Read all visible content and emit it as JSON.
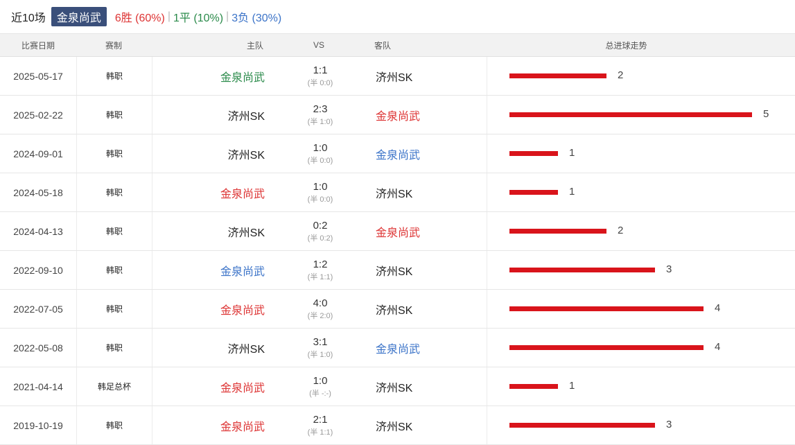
{
  "header": {
    "title": "近10场",
    "team": "金泉尚武",
    "wins": "6胜 (60%)",
    "draws": "1平 (10%)",
    "losses": "3负 (30%)",
    "separator": "|"
  },
  "columns": {
    "date": "比赛日期",
    "competition": "赛制",
    "home": "主队",
    "vs": "VS",
    "away": "客队",
    "trend": "总进球走势"
  },
  "colors": {
    "red": "#d33333",
    "green": "#2a8a4a",
    "blue": "#3b73c8",
    "bar": "#d9141b",
    "badge": "#3a4f7a"
  },
  "matches": [
    {
      "date": "2025-05-17",
      "comp": "韩职",
      "home": "金泉尚武",
      "home_color": "green",
      "score": "1:1",
      "half": "(半 0:0)",
      "away": "济州SK",
      "away_color": "plain",
      "total": 2
    },
    {
      "date": "2025-02-22",
      "comp": "韩职",
      "home": "济州SK",
      "home_color": "plain",
      "score": "2:3",
      "half": "(半 1:0)",
      "away": "金泉尚武",
      "away_color": "red",
      "total": 5
    },
    {
      "date": "2024-09-01",
      "comp": "韩职",
      "home": "济州SK",
      "home_color": "plain",
      "score": "1:0",
      "half": "(半 0:0)",
      "away": "金泉尚武",
      "away_color": "blue",
      "total": 1
    },
    {
      "date": "2024-05-18",
      "comp": "韩职",
      "home": "金泉尚武",
      "home_color": "red",
      "score": "1:0",
      "half": "(半 0:0)",
      "away": "济州SK",
      "away_color": "plain",
      "total": 1
    },
    {
      "date": "2024-04-13",
      "comp": "韩职",
      "home": "济州SK",
      "home_color": "plain",
      "score": "0:2",
      "half": "(半 0:2)",
      "away": "金泉尚武",
      "away_color": "red",
      "total": 2
    },
    {
      "date": "2022-09-10",
      "comp": "韩职",
      "home": "金泉尚武",
      "home_color": "blue",
      "score": "1:2",
      "half": "(半 1:1)",
      "away": "济州SK",
      "away_color": "plain",
      "total": 3
    },
    {
      "date": "2022-07-05",
      "comp": "韩职",
      "home": "金泉尚武",
      "home_color": "red",
      "score": "4:0",
      "half": "(半 2:0)",
      "away": "济州SK",
      "away_color": "plain",
      "total": 4
    },
    {
      "date": "2022-05-08",
      "comp": "韩职",
      "home": "济州SK",
      "home_color": "plain",
      "score": "3:1",
      "half": "(半 1:0)",
      "away": "金泉尚武",
      "away_color": "blue",
      "total": 4
    },
    {
      "date": "2021-04-14",
      "comp": "韩足总杯",
      "home": "金泉尚武",
      "home_color": "red",
      "score": "1:0",
      "half": "(半 -:-)",
      "away": "济州SK",
      "away_color": "plain",
      "total": 1
    },
    {
      "date": "2019-10-19",
      "comp": "韩职",
      "home": "金泉尚武",
      "home_color": "red",
      "score": "2:1",
      "half": "(半 1:1)",
      "away": "济州SK",
      "away_color": "plain",
      "total": 3
    }
  ]
}
